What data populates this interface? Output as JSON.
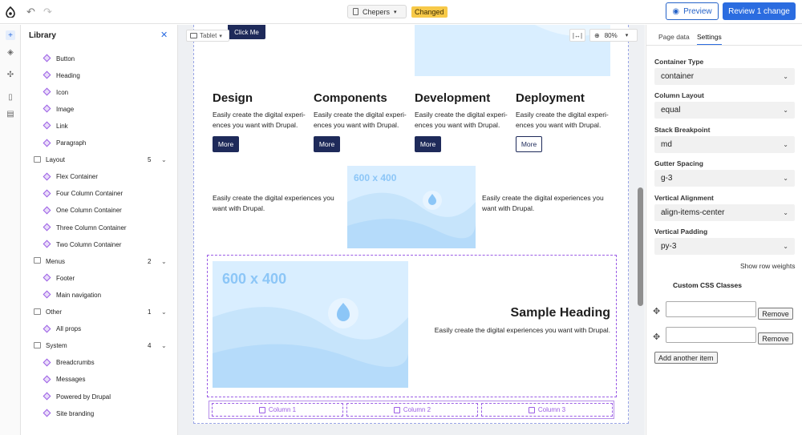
{
  "topbar": {
    "page_name": "Chepers",
    "changed_badge": "Changed",
    "preview_label": "Preview",
    "review_label": "Review 1 change"
  },
  "library": {
    "title": "Library",
    "items": [
      {
        "label": "Button",
        "type": "item"
      },
      {
        "label": "Heading",
        "type": "item"
      },
      {
        "label": "Icon",
        "type": "item"
      },
      {
        "label": "Image",
        "type": "item"
      },
      {
        "label": "Link",
        "type": "item"
      },
      {
        "label": "Paragraph",
        "type": "item"
      },
      {
        "label": "Layout",
        "type": "group",
        "count": "5"
      },
      {
        "label": "Flex Container",
        "type": "item"
      },
      {
        "label": "Four Column Container",
        "type": "item"
      },
      {
        "label": "One Column Container",
        "type": "item"
      },
      {
        "label": "Three Column Container",
        "type": "item"
      },
      {
        "label": "Two Column Container",
        "type": "item"
      },
      {
        "label": "Menus",
        "type": "group",
        "count": "2"
      },
      {
        "label": "Footer",
        "type": "item"
      },
      {
        "label": "Main navigation",
        "type": "item"
      },
      {
        "label": "Other",
        "type": "group",
        "count": "1"
      },
      {
        "label": "All props",
        "type": "item"
      },
      {
        "label": "System",
        "type": "group",
        "count": "4"
      },
      {
        "label": "Breadcrumbs",
        "type": "item"
      },
      {
        "label": "Messages",
        "type": "item"
      },
      {
        "label": "Powered by Drupal",
        "type": "item"
      },
      {
        "label": "Site branding",
        "type": "item"
      }
    ]
  },
  "canvas": {
    "viewport_label": "Tablet",
    "zoom_label": "80%",
    "click_me": "Click Me",
    "cards": [
      {
        "title": "Design",
        "text": "Easily create the digital experi-ences you want with Drupal.",
        "button": "More"
      },
      {
        "title": "Components",
        "text": "Easily create the digital experi-ences you want with Drupal.",
        "button": "More"
      },
      {
        "title": "Development",
        "text": "Easily create the digital experi-ences you want with Drupal.",
        "button": "More"
      },
      {
        "title": "Deployment",
        "text": "Easily create the digital experi-ences you want with Drupal.",
        "button": "More"
      }
    ],
    "mid_text_left": "Easily create the digital experiences you want with Drupal.",
    "mid_text_right": "Easily create the digital experiences you want with Drupal.",
    "img_small_label": "600 x 400",
    "img_large_label": "600 x 400",
    "sample_heading": "Sample Heading",
    "sample_text": "Easily create the digital experiences you want with Drupal.",
    "columns": [
      "Column 1",
      "Column 2",
      "Column 3"
    ]
  },
  "panel": {
    "tabs": [
      "Page data",
      "Settings"
    ],
    "fields": [
      {
        "label": "Container Type",
        "value": "container"
      },
      {
        "label": "Column Layout",
        "value": "equal"
      },
      {
        "label": "Stack Breakpoint",
        "value": "md"
      },
      {
        "label": "Gutter Spacing",
        "value": "g-3"
      },
      {
        "label": "Vertical Alignment",
        "value": "align-items-center"
      },
      {
        "label": "Vertical Padding",
        "value": "py-3"
      }
    ],
    "show_row_weights": "Show row weights",
    "css_title": "Custom CSS Classes",
    "remove_label": "Remove",
    "add_item": "Add another item"
  },
  "colors": {
    "accent": "#2b6ce0",
    "dark_button": "#1e2a5a",
    "purple": "#9b5de5",
    "placeholder_bg": "#d9eeff",
    "badge": "#f7c948"
  }
}
